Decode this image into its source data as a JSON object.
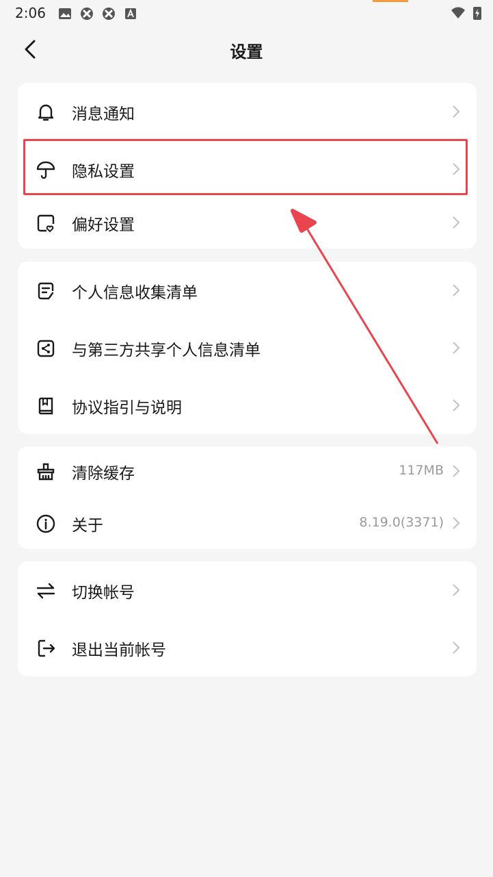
{
  "status_bar": {
    "time": "2:06"
  },
  "header": {
    "title": "设置"
  },
  "groups": [
    {
      "items": [
        {
          "label": "消息通知",
          "icon": "bell-icon"
        },
        {
          "label": "隐私设置",
          "icon": "umbrella-icon"
        },
        {
          "label": "偏好设置",
          "icon": "heart-card-icon"
        }
      ]
    },
    {
      "items": [
        {
          "label": "个人信息收集清单",
          "icon": "document-edit-icon"
        },
        {
          "label": "与第三方共享个人信息清单",
          "icon": "share-icon"
        },
        {
          "label": "协议指引与说明",
          "icon": "book-icon"
        }
      ]
    },
    {
      "items": [
        {
          "label": "清除缓存",
          "icon": "broom-icon",
          "value": "117MB"
        },
        {
          "label": "关于",
          "icon": "info-icon",
          "value": "8.19.0(3371)"
        }
      ]
    },
    {
      "items": [
        {
          "label": "切换帐号",
          "icon": "switch-icon"
        },
        {
          "label": "退出当前帐号",
          "icon": "logout-icon"
        }
      ]
    }
  ],
  "colors": {
    "highlight": "#e8454f",
    "arrow": "#e8454f",
    "background": "#f5f5f5",
    "card": "#ffffff"
  }
}
